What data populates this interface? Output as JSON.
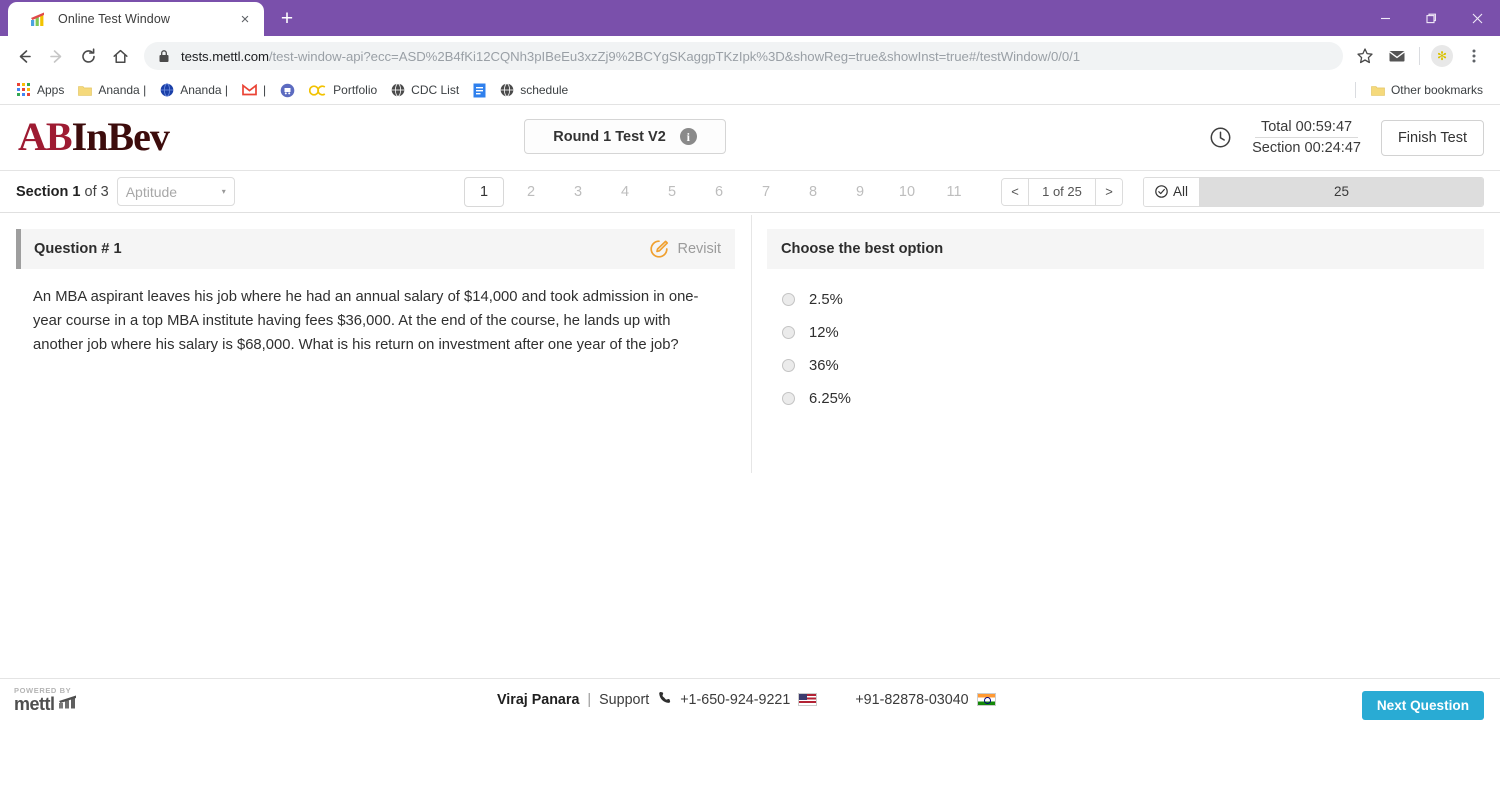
{
  "browser": {
    "tab": {
      "title": "Online Test Window",
      "favicon": "mettl-chart-icon",
      "close_label": "×"
    },
    "new_tab_label": "+",
    "window_controls": {
      "minimize": "minimize-icon",
      "maximize": "restore-icon",
      "close": "close-icon"
    },
    "nav": {
      "back": "back-arrow-icon",
      "forward": "forward-arrow-icon",
      "reload": "reload-icon",
      "home": "home-icon"
    },
    "omnibox": {
      "lock": "lock-icon",
      "host": "tests.mettl.com",
      "path": "/test-window-api?ecc=ASD%2B4fKi12CQNh3pIBeEu3xzZj9%2BCYgSKaggpTKzIpk%3D&showReg=true&showInst=true#/testWindow/0/0/1"
    },
    "toolbar_right": {
      "bookmark_star": "star-icon",
      "mail": "envelope-icon",
      "profile": "avatar-flower-icon",
      "menu": "three-dot-menu-icon"
    },
    "bookmarks": [
      {
        "label": "Apps",
        "icon": "apps-grid-icon"
      },
      {
        "label": "Ananda |",
        "icon": "folder-icon"
      },
      {
        "label": "Ananda |",
        "icon": "blue-globe-icon"
      },
      {
        "label": "|",
        "icon": "gmail-icon"
      },
      {
        "label": "",
        "icon": "railway-icon"
      },
      {
        "label": "Portfolio",
        "icon": "oc-icon"
      },
      {
        "label": "CDC List",
        "icon": "globe-icon"
      },
      {
        "label": "",
        "icon": "doc-icon"
      },
      {
        "label": "schedule",
        "icon": "globe-icon"
      }
    ],
    "other_bookmarks": {
      "label": "Other bookmarks",
      "icon": "folder-icon"
    }
  },
  "app": {
    "brand": {
      "ab": "AB",
      "inbev": "InBev"
    },
    "test_name": "Round 1 Test V2",
    "info_icon": "info-icon",
    "clock_icon": "clock-icon",
    "timer_total": "Total 00:59:47",
    "timer_section": "Section 00:24:47",
    "finish_test": "Finish Test",
    "section": {
      "prefix": "Section",
      "number": "1",
      "of": "of 3",
      "selected": "Aptitude",
      "caret": "▾"
    },
    "pager": {
      "numbers": [
        "1",
        "2",
        "3",
        "4",
        "5",
        "6",
        "7",
        "8",
        "9",
        "10",
        "11"
      ],
      "active": "1",
      "prev": "<",
      "next": ">",
      "page_of": "1 of 25"
    },
    "counter": {
      "all_label": "All",
      "all_icon": "check-circle-icon",
      "value": "25"
    },
    "question": {
      "title": "Question # 1",
      "revisit_label": "Revisit",
      "revisit_icon": "pencil-edit-icon",
      "text": "An MBA aspirant leaves his job where he had an annual salary of $14,000 and took admission in one-year course in a top MBA institute having fees $36,000. At the end of the course, he lands up with another job where his salary is $68,000. What is his return on investment after one year of the job?"
    },
    "options_panel": {
      "title": "Choose the best option",
      "options": [
        {
          "label": "2.5%"
        },
        {
          "label": "12%"
        },
        {
          "label": "36%"
        },
        {
          "label": "6.25%"
        }
      ]
    },
    "footer": {
      "powered_by": "POWERED BY",
      "powered_logo_text": "mettl",
      "user_name": "Viraj Panara",
      "separator": "|",
      "support_label": "Support",
      "phone_icon": "phone-icon",
      "phone_us": "+1-650-924-9221",
      "flag_us": "us-flag",
      "phone_in": "+91-82878-03040",
      "flag_in": "india-flag",
      "next_question": "Next Question"
    }
  },
  "colors": {
    "chrome_purple": "#7a50ab",
    "brand_red": "#9e1b32",
    "accent_cyan": "#29abd4",
    "revisit_orange": "#f0a030"
  }
}
